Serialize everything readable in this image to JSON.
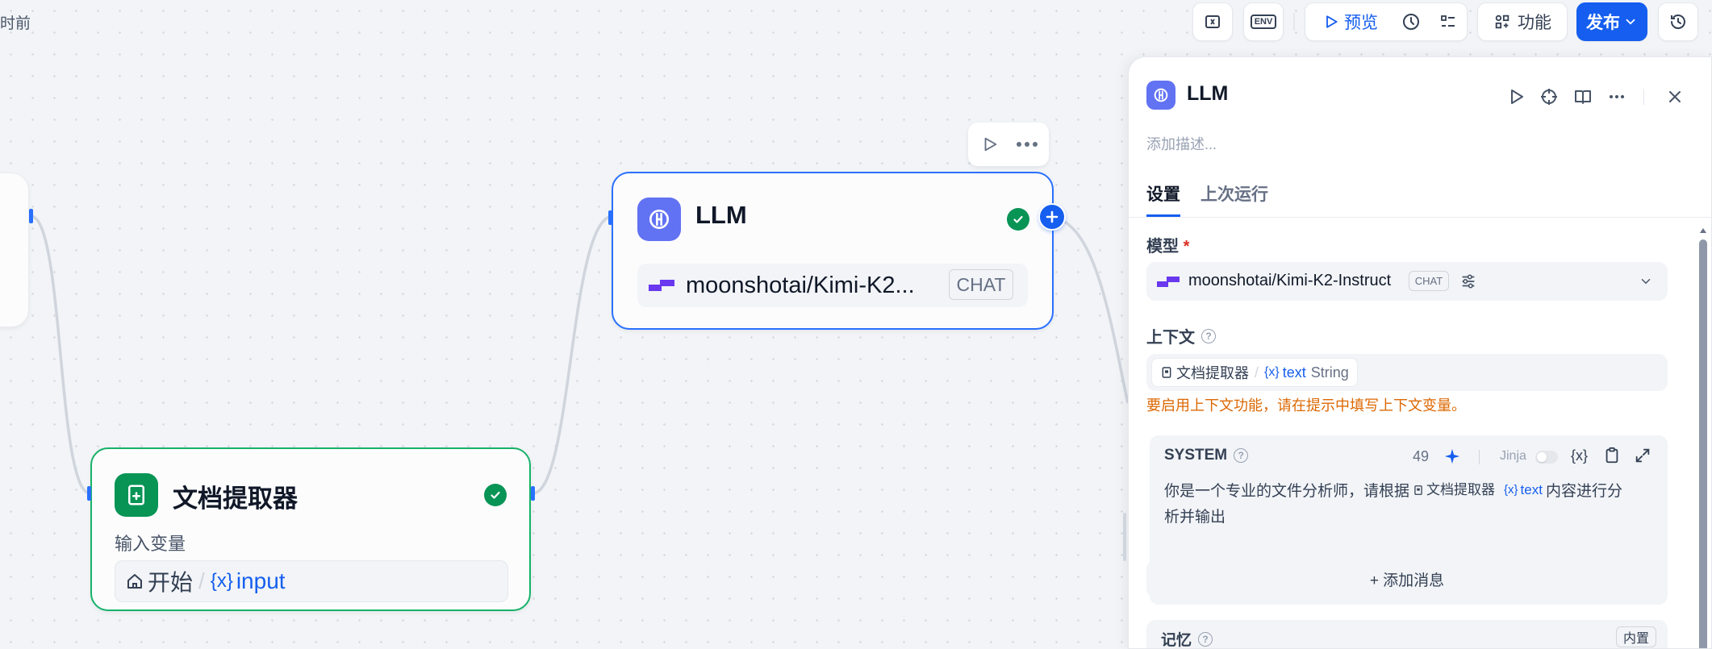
{
  "canvas": {
    "timestamp_fragment": "时前",
    "llm_node": {
      "title": "LLM",
      "model": "moonshotai/Kimi-K2...",
      "model_badge": "CHAT"
    },
    "doc_node": {
      "title": "文档提取器",
      "input_label": "输入变量",
      "var_source": "开始",
      "var_separator": "/",
      "var_prefix": "{x}",
      "var_name": "input"
    }
  },
  "toolbar": {
    "env_label": "ENV",
    "preview_label": "预览",
    "features_label": "功能",
    "publish_label": "发布"
  },
  "panel": {
    "title": "LLM",
    "description_placeholder": "添加描述...",
    "tabs": [
      {
        "label": "设置",
        "active": true
      },
      {
        "label": "上次运行",
        "active": false
      }
    ],
    "model": {
      "label": "模型",
      "required_mark": "*",
      "name": "moonshotai/Kimi-K2-Instruct",
      "badge": "CHAT"
    },
    "context": {
      "label": "上下文",
      "source": "文档提取器",
      "separator": "/",
      "var_prefix": "{x}",
      "var_name": "text",
      "var_type": "String",
      "warning": "要启用上下文功能，请在提示中填写上下文变量。"
    },
    "system": {
      "label": "SYSTEM",
      "token_count": "49",
      "jinja_label": "Jinja",
      "var_button": "{x}",
      "text_before": "你是一个专业的文件分析师，请根据",
      "chip_source": "文档提取器",
      "chip_prefix": "{x}",
      "chip_var": "text",
      "text_after_line1": "内容进行分",
      "text_line2": "析并输出"
    },
    "add_message": "+ 添加消息",
    "memory": {
      "label": "记忆",
      "badge": "内置"
    }
  },
  "colors": {
    "accent": "#155eef",
    "success": "#079455",
    "llm_icon": "#6172f3",
    "doc_icon": "#079455",
    "warning": "#dc6803"
  }
}
